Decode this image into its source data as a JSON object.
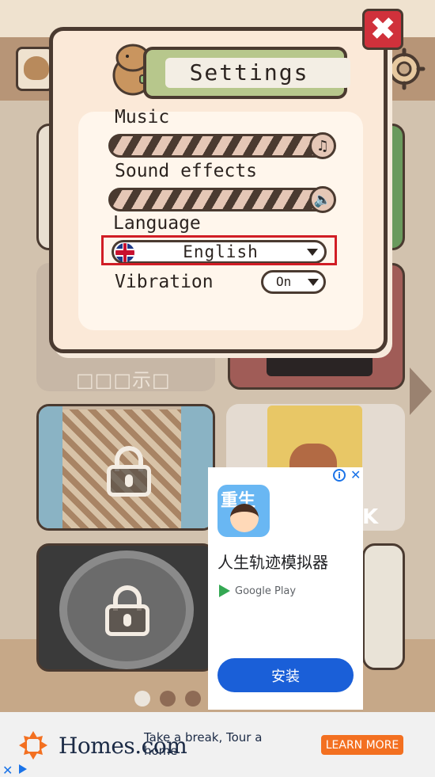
{
  "settings": {
    "title": "Settings",
    "music_label": "Music",
    "sound_effects_label": "Sound effects",
    "language_label": "Language",
    "language_value": "English",
    "vibration_label": "Vibration",
    "vibration_value": "On",
    "music_icon": "music-note-icon",
    "sound_icon": "speaker-icon",
    "close_icon": "close-icon"
  },
  "background": {
    "card_label": "□□□示□",
    "card_k_letter": "K",
    "pager": {
      "pages": 3,
      "active_index": 0
    }
  },
  "ad_panel": {
    "app_icon_text": "重生",
    "app_name": "人生轨迹模拟器",
    "store": "Google Play",
    "install_label": "安装"
  },
  "banner": {
    "brand": "Homes.com",
    "message": "Take a break, Tour a home",
    "cta": "LEARN MORE"
  },
  "colors": {
    "close_red": "#d0313b",
    "highlight_red": "#d11d25",
    "install_blue": "#1a5fd8",
    "cta_orange": "#f37021"
  }
}
